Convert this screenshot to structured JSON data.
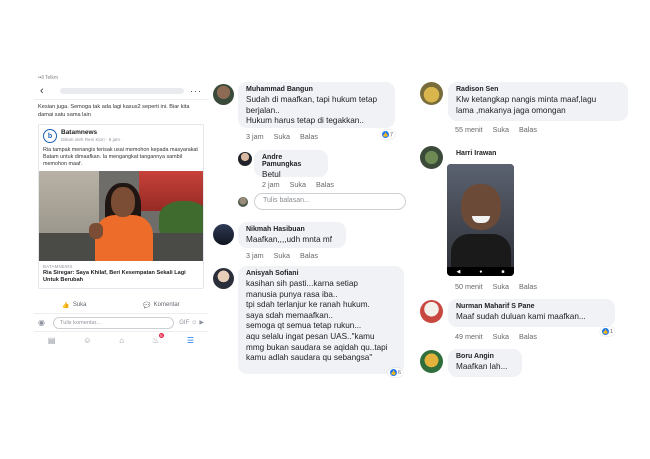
{
  "phone": {
    "status_left": "••ll Telkm",
    "caption": "Kesian juga. Semoga tak ada lagi kasus2 seperti ini. Biar kita damai satu sama lain",
    "share": {
      "page_name": "Batamnews",
      "meta": "Diikuti oleh Reni Kiori · 6 jam ·",
      "text": "Ria tampak menangis terisak usai memohon kepada masyarakat Batam untuk dimaafkan. Ia mengangkat tangannya sambil memohon maaf.",
      "source": "BATAMNEWS",
      "title": "Ria Siregar: Saya Khilaf, Beri Kesempatan Sekali Lagi Untuk Berubah"
    },
    "actions": {
      "like": "Suka",
      "comment": "Komentar"
    },
    "composer_placeholder": "Tulis komentar...",
    "notif_count": "6"
  },
  "comments_mid": [
    {
      "name": "Muhammad Bangun",
      "text": "Sudah di maafkan, tapi hukum tetap\nberjalan..\nHukum harus tetap di tegakkan..",
      "time": "3 jam",
      "like": "Suka",
      "reply": "Balas",
      "reactions": "7"
    },
    {
      "name": "Andre Pamungkas",
      "text": "Betul",
      "time": "2 jam",
      "like": "Suka",
      "reply": "Balas"
    },
    {
      "name": "Nikmah Hasibuan",
      "text": "Maafkan,,,,udh mnta mf",
      "time": "3 jam",
      "like": "Suka",
      "reply": "Balas"
    },
    {
      "name": "Anisyah Sofiani",
      "text": "kasihan sih pasti...karna setiap\nmanusia punya rasa iba..\ntpi sdah terlanjur ke ranah hukum.\nsaya sdah memaafkan..\nsemoga qt semua tetap rukun...\naqu selalu ingat pesan UAS..\"kamu\nmmg bukan saudara se aqidah qu..tapi\nkamu adlah saudara qu sebangsa\"",
      "reactions": "6"
    }
  ],
  "reply_placeholder": "Tulis balasan...",
  "comments_right": [
    {
      "name": "Radison Sen",
      "text": "Klw ketangkap nangis minta maaf,lagu\nlama ,makanya jaga omongan",
      "time": "55 menit",
      "like": "Suka",
      "reply": "Balas"
    },
    {
      "name": "Harri Irawan",
      "time": "50 menit",
      "like": "Suka",
      "reply": "Balas"
    },
    {
      "name": "Nurman Maharif S Pane",
      "text": "Maaf  sudah duluan kami maafkan...",
      "time": "49 menit",
      "like": "Suka",
      "reply": "Balas",
      "reactions": "1"
    },
    {
      "name": "Boru Angin",
      "text": "Maafkan lah..."
    }
  ]
}
